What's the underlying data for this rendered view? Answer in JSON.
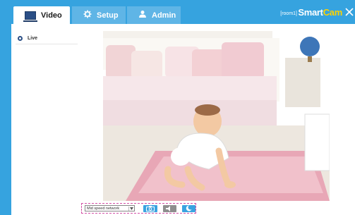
{
  "tabs": [
    {
      "label": "Video",
      "icon": "monitor-icon",
      "active": true
    },
    {
      "label": "Setup",
      "icon": "gear-icon",
      "active": false
    },
    {
      "label": "Admin",
      "icon": "person-icon",
      "active": false
    }
  ],
  "header": {
    "room_label": "[room1]",
    "brand_primary": "Smart",
    "brand_secondary": "Cam",
    "close_icon": "close-icon"
  },
  "sidebar": {
    "items": [
      {
        "label": "Live",
        "icon": "live-dot-icon"
      }
    ]
  },
  "controls": {
    "network_select": "Mid speed network",
    "buttons": [
      "snapshot-camera-icon",
      "speaker-icon",
      "night-mode-icon"
    ]
  },
  "colors": {
    "accent": "#36a3df",
    "tab_inactive": "#5fb5e6",
    "brand_highlight": "#ffd200",
    "control_border": "#d24fa5"
  }
}
